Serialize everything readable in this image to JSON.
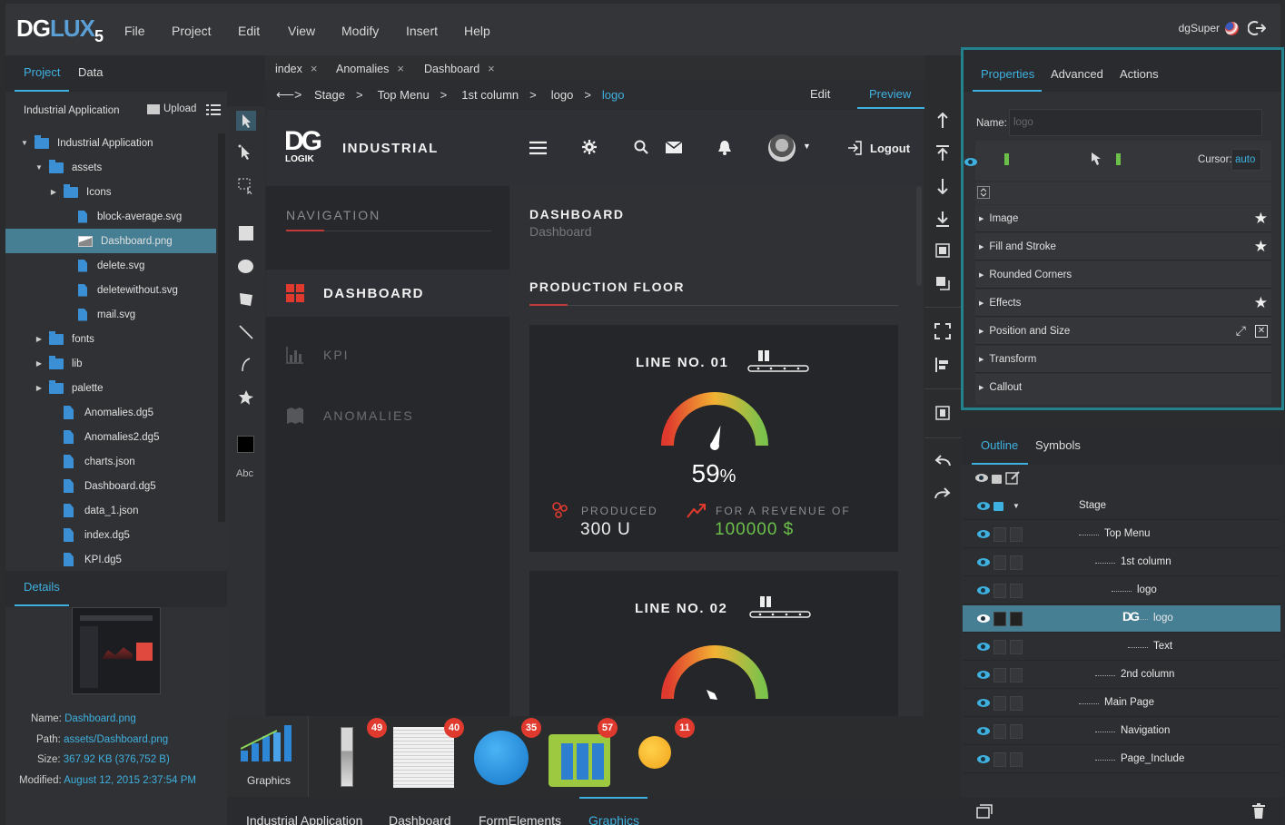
{
  "app": {
    "logo": "DGLUX",
    "logo_suffix": "5",
    "user": "dgSuper"
  },
  "menu": [
    "File",
    "Project",
    "Edit",
    "View",
    "Modify",
    "Insert",
    "Help"
  ],
  "left": {
    "tabs": [
      "Project",
      "Data"
    ],
    "project_label": "Industrial Application",
    "upload_label": "Upload",
    "tree": [
      {
        "label": "Industrial Application",
        "type": "folder",
        "arrow": "▼"
      },
      {
        "label": "assets",
        "type": "folder",
        "arrow": "▼"
      },
      {
        "label": "Icons",
        "type": "folder",
        "arrow": "▶"
      },
      {
        "label": "block-average.svg",
        "type": "file"
      },
      {
        "label": "Dashboard.png",
        "type": "image"
      },
      {
        "label": "delete.svg",
        "type": "file"
      },
      {
        "label": "deletewithout.svg",
        "type": "file"
      },
      {
        "label": "mail.svg",
        "type": "file"
      },
      {
        "label": "fonts",
        "type": "folder",
        "arrow": "▶"
      },
      {
        "label": "lib",
        "type": "folder",
        "arrow": "▶"
      },
      {
        "label": "palette",
        "type": "folder",
        "arrow": "▶"
      },
      {
        "label": "Anomalies.dg5",
        "type": "dg"
      },
      {
        "label": "Anomalies2.dg5",
        "type": "dg"
      },
      {
        "label": "charts.json",
        "type": "dg"
      },
      {
        "label": "Dashboard.dg5",
        "type": "dg"
      },
      {
        "label": "data_1.json",
        "type": "dg"
      },
      {
        "label": "index.dg5",
        "type": "dg"
      },
      {
        "label": "KPI.dg5",
        "type": "dg"
      }
    ],
    "details_tab": "Details",
    "details": {
      "name_label": "Name:",
      "name": "Dashboard.png",
      "path_label": "Path:",
      "path": "assets/Dashboard.png",
      "size_label": "Size:",
      "size": "367.92 KB (376,752 B)",
      "modified_label": "Modified:",
      "modified": "August 12, 2015 2:37:54 PM"
    }
  },
  "tools": {
    "text_tool": "Abc"
  },
  "editor": {
    "tabs": [
      "index",
      "Anomalies",
      "Dashboard"
    ],
    "crumbs": [
      "Stage",
      "Top Menu",
      "1st column",
      "logo",
      "logo"
    ],
    "edit_label": "Edit",
    "preview_label": "Preview"
  },
  "canvas": {
    "brand_logo": "DG",
    "brand_logo_sub": "LOGIK",
    "brand": "INDUSTRIAL",
    "logout": "Logout",
    "nav_title": "NAVIGATION",
    "nav_items": [
      "DASHBOARD",
      "KPI",
      "ANOMALIES"
    ],
    "page_title": "DASHBOARD",
    "page_sub": "Dashboard",
    "section": "PRODUCTION FLOOR",
    "line1": "LINE NO. 01",
    "gauge_value": "59",
    "gauge_unit": "%",
    "gauge_percent": 59,
    "produced_label": "PRODUCED",
    "produced_value": "300 U",
    "revenue_label": "FOR A REVENUE OF",
    "revenue_value": "100000 $",
    "line2": "LINE NO. 02"
  },
  "properties": {
    "tabs": [
      "Properties",
      "Advanced",
      "Actions"
    ],
    "name_label": "Name:",
    "name_placeholder": "logo",
    "cursor_label": "Cursor:",
    "cursor_value": "auto",
    "sections": [
      "Image",
      "Fill and Stroke",
      "Rounded Corners",
      "Effects",
      "Position and Size",
      "Transform",
      "Callout"
    ]
  },
  "outline": {
    "tabs": [
      "Outline",
      "Symbols"
    ],
    "rows": [
      "Stage",
      "Top Menu",
      "1st column",
      "logo",
      "logo",
      "Text",
      "2nd column",
      "Main Page",
      "Navigation",
      "Page_Include"
    ]
  },
  "bottom": {
    "widget_label": "Graphics",
    "badges": [
      "49",
      "40",
      "35",
      "57",
      "11"
    ],
    "tabs": [
      "Industrial Application",
      "Dashboard",
      "FormElements",
      "Graphics"
    ]
  },
  "colors": {
    "accent": "#3fb1e0",
    "selection": "#467f93",
    "highlight_border": "#22838f",
    "badge": "#e03a2e",
    "positive": "#6cc04a"
  }
}
